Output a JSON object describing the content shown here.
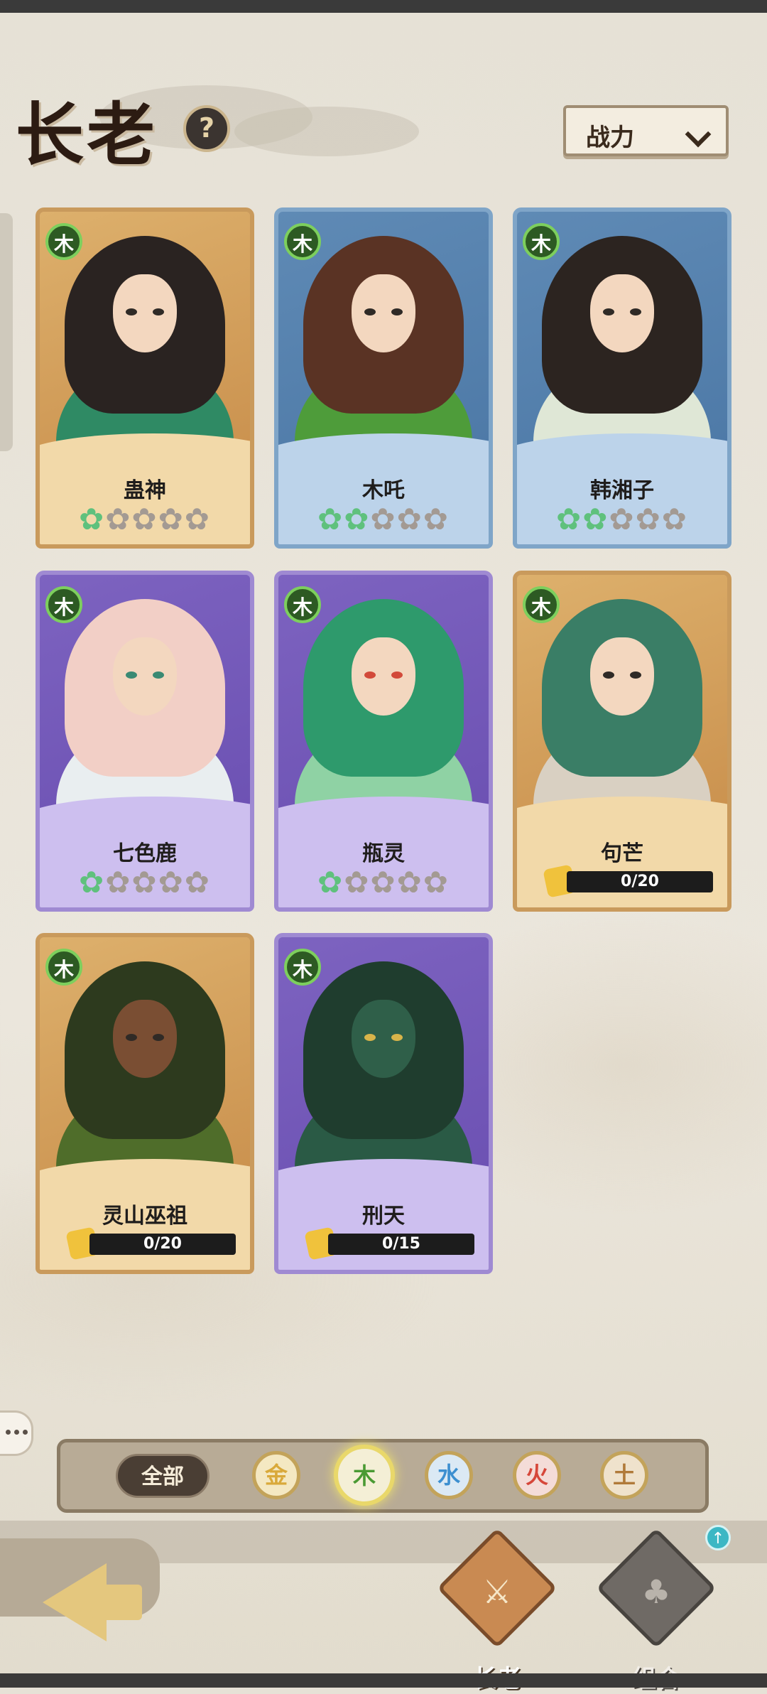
{
  "header": {
    "title": "长老",
    "help_label": "?"
  },
  "sort": {
    "label": "战力"
  },
  "cards": [
    {
      "name": "蛊神",
      "element": "木",
      "frame": "gold",
      "stars_filled": 1,
      "stars_total": 5
    },
    {
      "name": "木吒",
      "element": "木",
      "frame": "blue",
      "stars_filled": 2,
      "stars_total": 5
    },
    {
      "name": "韩湘子",
      "element": "木",
      "frame": "blue",
      "stars_filled": 2,
      "stars_total": 5
    },
    {
      "name": "七色鹿",
      "element": "木",
      "frame": "purple",
      "stars_filled": 1,
      "stars_total": 5
    },
    {
      "name": "瓶灵",
      "element": "木",
      "frame": "purple",
      "stars_filled": 1,
      "stars_total": 5
    },
    {
      "name": "句芒",
      "element": "木",
      "frame": "gold",
      "fragments": "0/20"
    },
    {
      "name": "灵山巫祖",
      "element": "木",
      "frame": "gold",
      "fragments": "0/20"
    },
    {
      "name": "刑天",
      "element": "木",
      "frame": "purple",
      "fragments": "0/15"
    }
  ],
  "filter": {
    "all_label": "全部",
    "elements": [
      {
        "label": "金",
        "color": "#d9a93a",
        "active": false
      },
      {
        "label": "木",
        "color": "#4a9a33",
        "active": true
      },
      {
        "label": "水",
        "color": "#3c8fd0",
        "active": false
      },
      {
        "label": "火",
        "color": "#d6473a",
        "active": false
      },
      {
        "label": "土",
        "color": "#b07a3a",
        "active": false
      }
    ]
  },
  "nav": {
    "elders_label": "长老",
    "combo_label": "组合",
    "upgrade_badge": "↑"
  },
  "colors": {
    "wood": "#4a9a33",
    "accent_gold": "#e4c77e",
    "star_on": "#5fc17d",
    "star_off": "#a39a93"
  }
}
